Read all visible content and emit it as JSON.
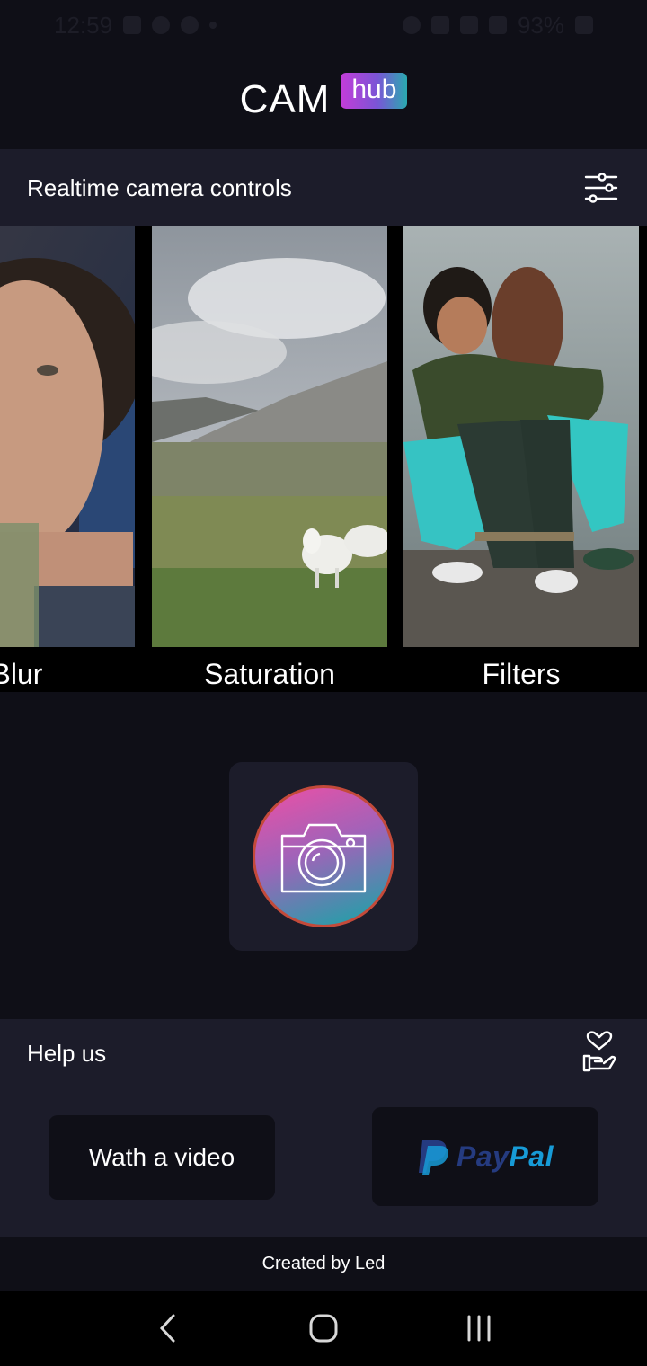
{
  "status_bar": {
    "time": "12:59",
    "battery": "93%"
  },
  "header": {
    "title": "CAM",
    "badge": "hub"
  },
  "controls": {
    "title": "Realtime camera controls",
    "cards": [
      {
        "label": "Blur"
      },
      {
        "label": "Saturation"
      },
      {
        "label": "Filters"
      }
    ]
  },
  "help": {
    "title": "Help us",
    "watch_label": "Wath a video",
    "paypal_label_pay": "Pay",
    "paypal_label_pal": "Pal"
  },
  "footer": {
    "text": "Created by Led"
  },
  "colors": {
    "background": "#0f0f17",
    "panel": "#1c1c2a",
    "paypal_dark": "#253b80",
    "paypal_light": "#179bd7"
  },
  "icons": {
    "controls": "sliders-icon",
    "help": "hand-heart-icon",
    "camera": "camera-icon"
  }
}
